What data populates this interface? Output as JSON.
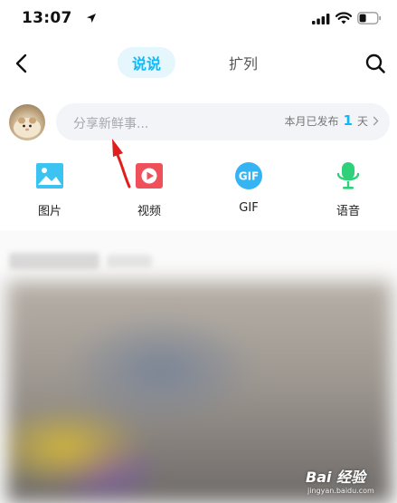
{
  "status_bar": {
    "time": "13:07"
  },
  "nav": {
    "tabs": [
      {
        "label": "说说",
        "active": true
      },
      {
        "label": "扩列",
        "active": false
      }
    ]
  },
  "compose": {
    "placeholder": "分享新鲜事...",
    "stat_prefix": "本月已发布",
    "stat_count": "1",
    "stat_unit": "天"
  },
  "actions": [
    {
      "label": "图片",
      "icon": "image-icon",
      "color": "#3cc3f2"
    },
    {
      "label": "视频",
      "icon": "video-icon",
      "color": "#f0505a"
    },
    {
      "label": "GIF",
      "icon": "gif-icon",
      "color": "#35b4f4"
    },
    {
      "label": "语音",
      "icon": "microphone-icon",
      "color": "#2fd07a"
    }
  ],
  "colors": {
    "accent": "#12b7f5",
    "tab_bg": "#e6f6fd"
  },
  "watermark": {
    "main": "Bai 经验",
    "sub": "jingyan.baidu.com"
  }
}
